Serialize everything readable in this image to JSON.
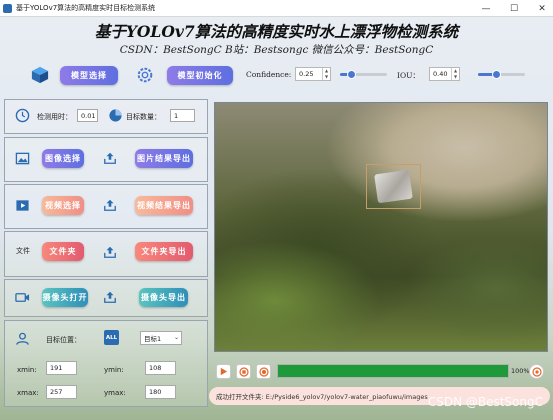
{
  "window": {
    "title": "基于YOLOv7算法的高精度实时目标检测系统",
    "minimize": "—",
    "maximize": "☐",
    "close": "✕"
  },
  "header": {
    "title": "基于YOLOv7算法的高精度实时水上漂浮物检测系统",
    "subtitle": "CSDN：BestSongC   B站：Bestsongc   微信公众号：BestSongC"
  },
  "toolbar": {
    "model_select": "模型选择",
    "model_init": "模型初始化",
    "confidence_label": "Confidence:",
    "confidence_value": "0.25",
    "confidence_level": 0.25,
    "iou_label": "IOU：",
    "iou_value": "0.40",
    "iou_level": 0.4
  },
  "stats": {
    "time_label": "检测用时：",
    "time_value": "0.01",
    "count_label": "目标数量：",
    "count_value": "1"
  },
  "image_section": {
    "select": "图像选择",
    "export": "图片结果导出"
  },
  "video_section": {
    "select": "视频选择",
    "export": "视频结果导出"
  },
  "folder_section": {
    "label": "文件",
    "select": "文件夹",
    "export": "文件夹导出"
  },
  "camera_section": {
    "open": "摄像头打开",
    "export": "摄像头导出"
  },
  "position": {
    "label": "目标位置：",
    "all_icon_text": "ALL",
    "target_selected": "目标1",
    "xmin_label": "xmin:",
    "xmin": "191",
    "ymin_label": "ymin:",
    "ymin": "108",
    "xmax_label": "xmax:",
    "xmax": "257",
    "ymax_label": "ymax:",
    "ymax": "180"
  },
  "progress": {
    "value": 1.0,
    "text": "100%"
  },
  "status": {
    "text": "成功打开文件夹: E:/Pyside6_yolov7/yolov7-water_piaofuwu/images"
  },
  "watermark": "CSDN @BestSongC",
  "colors": {
    "progress": "#1f9a3a",
    "accent_blue": "#4a78d0"
  }
}
